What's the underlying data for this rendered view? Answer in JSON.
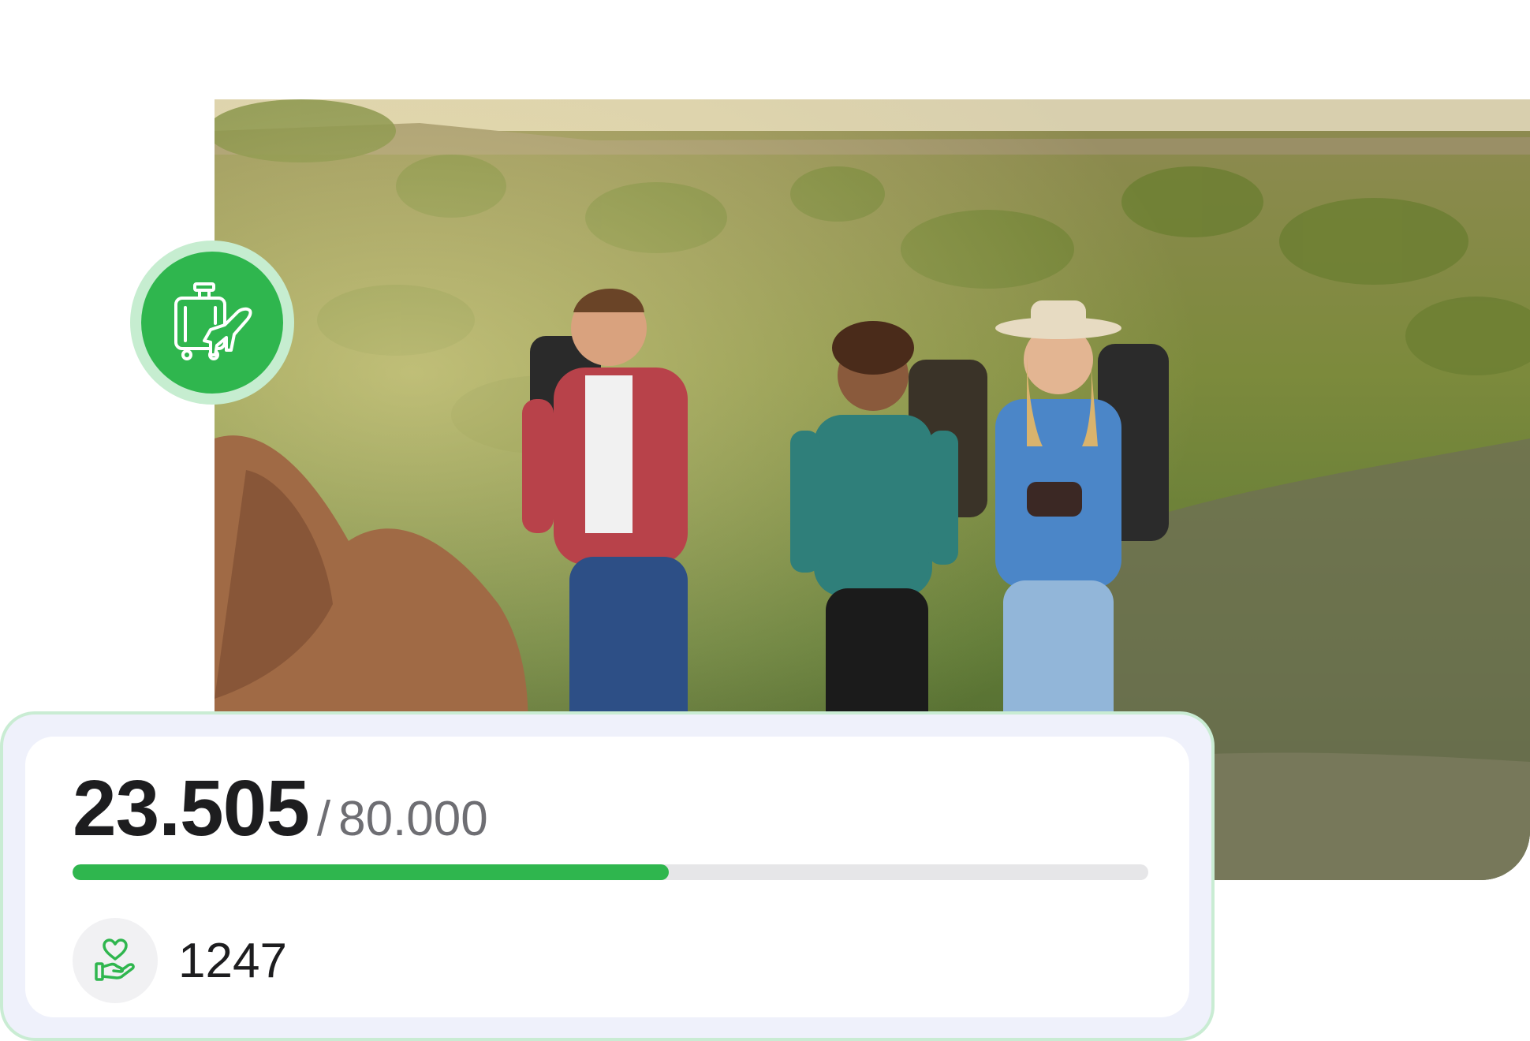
{
  "hero_image": {
    "description_icon": "hikers-landscape-photo"
  },
  "category_badge": {
    "icon": "luggage-airplane-icon",
    "color": "#2fb64e",
    "ring_color": "#c6edd0"
  },
  "fundraiser": {
    "raised": "23.505",
    "separator": "/",
    "goal": "80.000",
    "progress_fraction": 0.554,
    "accent_color": "#2fb64e",
    "donors_icon": "heart-hand-icon",
    "donors_count": "1247"
  }
}
